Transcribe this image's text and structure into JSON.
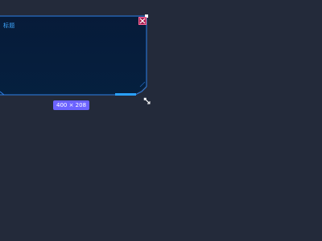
{
  "panel": {
    "title": "标题",
    "close_icon": "close-icon",
    "resize_icon": "resize-icon"
  },
  "badge": {
    "size_text": "400 × 208"
  },
  "colors": {
    "background": "#232a3a",
    "panel_fill": "#061c3b",
    "panel_border": "#2e7fe6",
    "title": "#3ea7ff",
    "close_bg": "#a61d4f",
    "badge_bg": "#6c63ff"
  }
}
